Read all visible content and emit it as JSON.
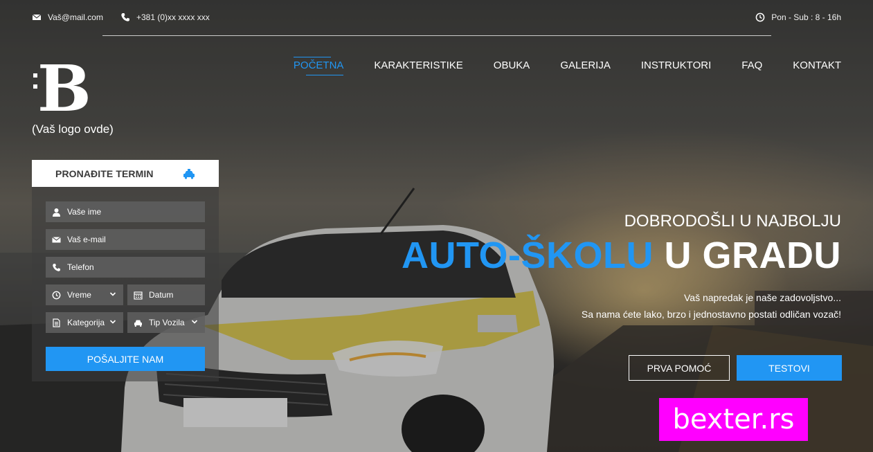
{
  "topbar": {
    "email": "Vaš@mail.com",
    "phone": "+381 (0)xx xxxx xxx",
    "hours": "Pon - Sub : 8 - 16h"
  },
  "logo": {
    "letter": "B",
    "caption": "(Vaš logo ovde)"
  },
  "nav": {
    "items": [
      {
        "label": "POČETNA",
        "active": true
      },
      {
        "label": "KARAKTERISTIKE"
      },
      {
        "label": "OBUKA"
      },
      {
        "label": "GALERIJA"
      },
      {
        "label": "INSTRUKTORI"
      },
      {
        "label": "FAQ"
      },
      {
        "label": "KONTAKT"
      }
    ]
  },
  "form": {
    "title": "PRONAĐITE TERMIN",
    "name_placeholder": "Vaše ime",
    "email_placeholder": "Vaš e-mail",
    "phone_placeholder": "Telefon",
    "time_label": "Vreme",
    "date_label": "Datum",
    "category_label": "Kategorija",
    "vehicle_label": "Tip Vozila",
    "submit_label": "POŠALJITE NAM"
  },
  "hero": {
    "welcome": "DOBRODOŠLI U NAJBOLJU",
    "headline_blue": "AUTO-ŠKOLU",
    "headline_white": "U GRADU",
    "sub1": "Vaš napredak je naše zadovoljstvo...",
    "sub2": "Sa nama ćete lako, brzo i jednostavno postati odličan vozač!",
    "btn_first_aid": "PRVA POMOĆ",
    "btn_tests": "TESTOVI"
  },
  "watermark": "bexter.rs",
  "colors": {
    "accent": "#2196f3",
    "watermark_bg": "#ff00ff"
  }
}
